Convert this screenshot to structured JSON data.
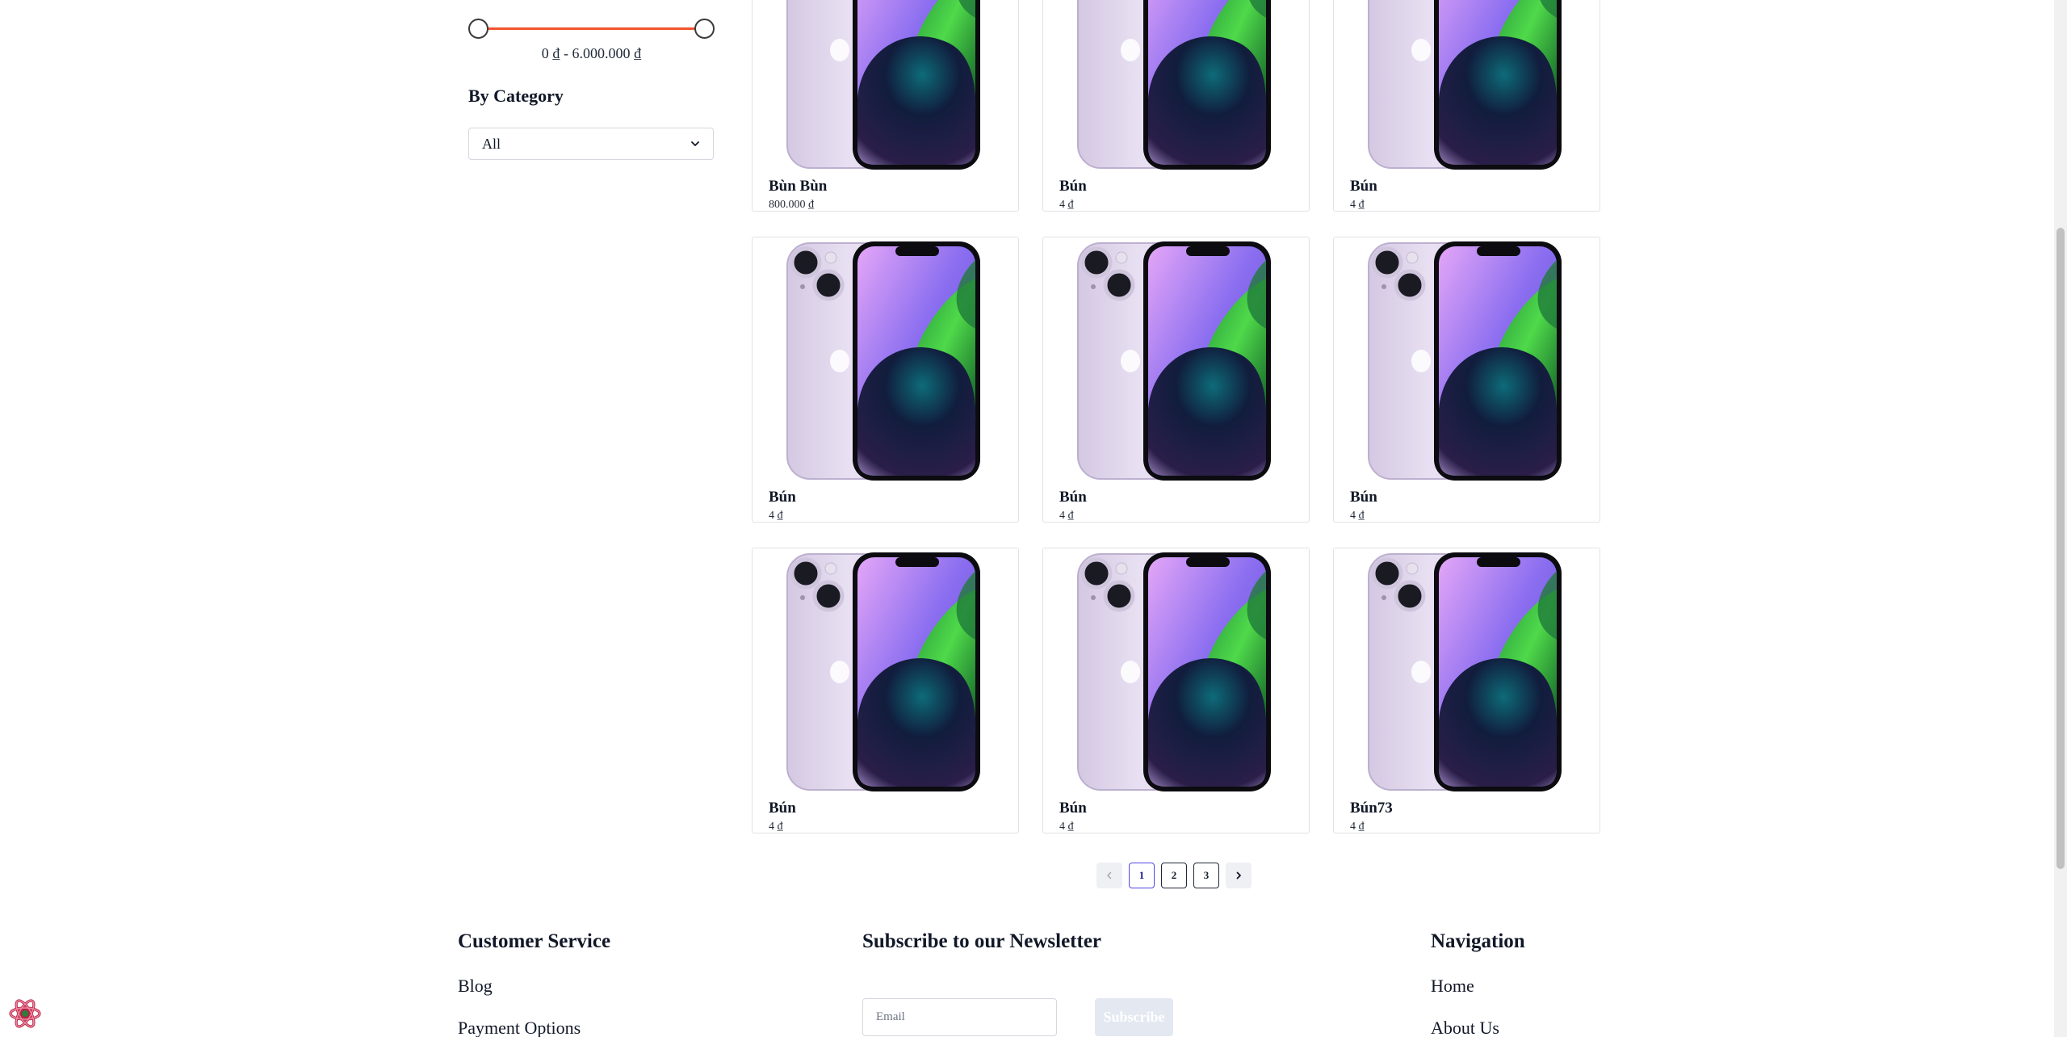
{
  "filters": {
    "price_min_fraction": 0,
    "price_max_fraction": 1,
    "price_range_text": "0 ₫ - 6.000.000 ₫",
    "category_heading": "By Category",
    "category_selected": "All"
  },
  "products": [
    {
      "name": "Bùn Bùn",
      "price": "800.000 ₫"
    },
    {
      "name": "Bún",
      "price": "4 ₫"
    },
    {
      "name": "Bún",
      "price": "4 ₫"
    },
    {
      "name": "Bún",
      "price": "4 ₫"
    },
    {
      "name": "Bún",
      "price": "4 ₫"
    },
    {
      "name": "Bún",
      "price": "4 ₫"
    },
    {
      "name": "Bún",
      "price": "4 ₫"
    },
    {
      "name": "Bún",
      "price": "4 ₫"
    },
    {
      "name": "Bún73",
      "price": "4 ₫"
    }
  ],
  "pagination": {
    "pages": [
      "1",
      "2",
      "3"
    ],
    "current": "1",
    "prev_icon": "chevron-left-icon",
    "next_icon": "chevron-right-icon"
  },
  "footer": {
    "customer_service": {
      "title": "Customer Service",
      "links": [
        "Blog",
        "Payment Options"
      ]
    },
    "newsletter": {
      "title": "Subscribe to our Newsletter",
      "email_placeholder": "Email",
      "subscribe_label": "Subscribe"
    },
    "navigation": {
      "title": "Navigation",
      "links": [
        "Home",
        "About Us"
      ]
    }
  },
  "colors": {
    "slider_accent": "#f2542d",
    "pagination_active": "#4f46e5",
    "subscribe_bg": "#e3e8f1"
  },
  "icons": {
    "category_select": "chevron-down-icon",
    "devtools": "react-devtools-icon"
  }
}
